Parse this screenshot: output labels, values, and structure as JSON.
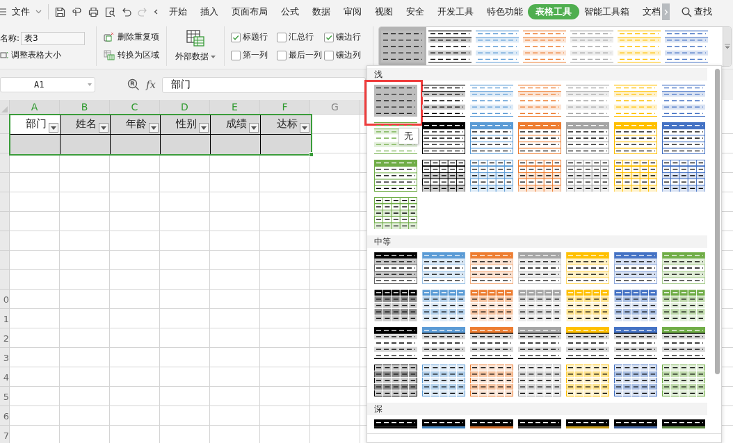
{
  "toolbar": {
    "file_menu": "文件",
    "tabs": [
      {
        "label": "开始",
        "selected": false
      },
      {
        "label": "插入",
        "selected": false
      },
      {
        "label": "页面布局",
        "selected": false
      },
      {
        "label": "公式",
        "selected": false
      },
      {
        "label": "数据",
        "selected": false
      },
      {
        "label": "审阅",
        "selected": false
      },
      {
        "label": "视图",
        "selected": false
      },
      {
        "label": "安全",
        "selected": false
      },
      {
        "label": "开发工具",
        "selected": false
      },
      {
        "label": "特色功能",
        "selected": false
      },
      {
        "label": "表格工具",
        "selected": true
      },
      {
        "label": "智能工具箱",
        "selected": false
      },
      {
        "label": "文档",
        "selected": false
      }
    ],
    "search": "查找"
  },
  "ribbon": {
    "table_name_label": "名称:",
    "table_name": "表3",
    "resize_button": "调整表格大小",
    "remove_duplicates_button": "删除重复项",
    "convert_button": "转换为区域",
    "external_data_button": "外部数据",
    "options": [
      {
        "label": "标题行",
        "checked": true
      },
      {
        "label": "汇总行",
        "checked": false
      },
      {
        "label": "镶边行",
        "checked": true
      },
      {
        "label": "第一列",
        "checked": false
      },
      {
        "label": "最后一列",
        "checked": false
      },
      {
        "label": "镶边列",
        "checked": false
      }
    ],
    "style_strip": [
      {
        "kind": "none",
        "color": "#bdbdbd",
        "selected": true
      },
      {
        "kind": "banded",
        "color": "#000000",
        "selected": false
      },
      {
        "kind": "banded",
        "color": "#5b9bd5",
        "selected": false
      },
      {
        "kind": "banded",
        "color": "#ed7d31",
        "selected": false
      },
      {
        "kind": "banded",
        "color": "#a5a5a5",
        "selected": false
      },
      {
        "kind": "banded",
        "color": "#ffc000",
        "selected": false
      },
      {
        "kind": "banded",
        "color": "#4472c4",
        "selected": false
      }
    ]
  },
  "formula_bar": {
    "cell_ref": "A1",
    "function_label": "fx",
    "value": "部门"
  },
  "sheet": {
    "columns": [
      {
        "label": "A",
        "selected": true
      },
      {
        "label": "B",
        "selected": true
      },
      {
        "label": "C",
        "selected": true
      },
      {
        "label": "D",
        "selected": true
      },
      {
        "label": "E",
        "selected": true
      },
      {
        "label": "F",
        "selected": true
      },
      {
        "label": "G",
        "selected": false
      }
    ],
    "headers": [
      {
        "text": "部门",
        "active": true
      },
      {
        "text": "姓名",
        "active": false
      },
      {
        "text": "年龄",
        "active": false
      },
      {
        "text": "性别",
        "active": false
      },
      {
        "text": "成绩",
        "active": false
      },
      {
        "text": "达标",
        "active": false
      }
    ],
    "row_number_tails": [
      "0",
      "1",
      "2",
      "3",
      "4",
      "5",
      "6",
      "7"
    ]
  },
  "style_gallery": {
    "tooltip": "无",
    "sections": [
      {
        "title": "浅",
        "items": [
          {
            "kind": "none",
            "color": "#bdbdbd",
            "selected": true
          },
          {
            "kind": "banded",
            "color": "#000000",
            "selected": false
          },
          {
            "kind": "banded",
            "color": "#5b9bd5",
            "selected": false
          },
          {
            "kind": "banded",
            "color": "#ed7d31",
            "selected": false
          },
          {
            "kind": "banded",
            "color": "#a5a5a5",
            "selected": false
          },
          {
            "kind": "banded",
            "color": "#ffc000",
            "selected": false
          },
          {
            "kind": "banded",
            "color": "#4472c4",
            "selected": false
          },
          {
            "kind": "banded",
            "color": "#70ad47",
            "selected": false
          },
          {
            "kind": "header",
            "color": "#000000",
            "selected": false
          },
          {
            "kind": "header",
            "color": "#5b9bd5",
            "selected": false
          },
          {
            "kind": "header",
            "color": "#ed7d31",
            "selected": false
          },
          {
            "kind": "header",
            "color": "#a5a5a5",
            "selected": false
          },
          {
            "kind": "header",
            "color": "#ffc000",
            "selected": false
          },
          {
            "kind": "header",
            "color": "#4472c4",
            "selected": false
          },
          {
            "kind": "header",
            "color": "#70ad47",
            "selected": false
          },
          {
            "kind": "grid",
            "color": "#000000",
            "selected": false
          },
          {
            "kind": "grid",
            "color": "#5b9bd5",
            "selected": false
          },
          {
            "kind": "grid",
            "color": "#ed7d31",
            "selected": false
          },
          {
            "kind": "grid",
            "color": "#a5a5a5",
            "selected": false
          },
          {
            "kind": "grid",
            "color": "#ffc000",
            "selected": false
          },
          {
            "kind": "grid",
            "color": "#4472c4",
            "selected": false
          },
          {
            "kind": "grid",
            "color": "#70ad47",
            "selected": false
          }
        ]
      },
      {
        "title": "中等",
        "items": [
          {
            "kind": "m-header",
            "color": "#000000",
            "selected": false
          },
          {
            "kind": "m-header",
            "color": "#5b9bd5",
            "selected": false
          },
          {
            "kind": "m-header",
            "color": "#ed7d31",
            "selected": false
          },
          {
            "kind": "m-header",
            "color": "#a5a5a5",
            "selected": false
          },
          {
            "kind": "m-header",
            "color": "#ffc000",
            "selected": false
          },
          {
            "kind": "m-header",
            "color": "#4472c4",
            "selected": false
          },
          {
            "kind": "m-header",
            "color": "#70ad47",
            "selected": false
          },
          {
            "kind": "m-cells",
            "color": "#000000",
            "selected": false
          },
          {
            "kind": "m-cells",
            "color": "#5b9bd5",
            "selected": false
          },
          {
            "kind": "m-cells",
            "color": "#ed7d31",
            "selected": false
          },
          {
            "kind": "m-cells",
            "color": "#a5a5a5",
            "selected": false
          },
          {
            "kind": "m-cells",
            "color": "#ffc000",
            "selected": false
          },
          {
            "kind": "m-cells",
            "color": "#4472c4",
            "selected": false
          },
          {
            "kind": "m-cells",
            "color": "#70ad47",
            "selected": false
          },
          {
            "kind": "m-lines",
            "color": "#000000",
            "selected": false
          },
          {
            "kind": "m-lines",
            "color": "#5b9bd5",
            "selected": false
          },
          {
            "kind": "m-lines",
            "color": "#ed7d31",
            "selected": false
          },
          {
            "kind": "m-lines",
            "color": "#a5a5a5",
            "selected": false
          },
          {
            "kind": "m-lines",
            "color": "#ffc000",
            "selected": false
          },
          {
            "kind": "m-lines",
            "color": "#4472c4",
            "selected": false
          },
          {
            "kind": "m-lines",
            "color": "#70ad47",
            "selected": false
          },
          {
            "kind": "m-grid",
            "color": "#000000",
            "selected": false
          },
          {
            "kind": "m-grid",
            "color": "#5b9bd5",
            "selected": false
          },
          {
            "kind": "m-grid",
            "color": "#ed7d31",
            "selected": false
          },
          {
            "kind": "m-grid",
            "color": "#a5a5a5",
            "selected": false
          },
          {
            "kind": "m-grid",
            "color": "#ffc000",
            "selected": false
          },
          {
            "kind": "m-grid",
            "color": "#4472c4",
            "selected": false
          },
          {
            "kind": "m-grid",
            "color": "#70ad47",
            "selected": false
          }
        ]
      },
      {
        "title": "深",
        "items": [
          {
            "kind": "dark",
            "color": "#000000",
            "selected": false
          },
          {
            "kind": "dark",
            "color": "#2e75b6",
            "selected": false
          },
          {
            "kind": "dark",
            "color": "#c55a11",
            "selected": false
          },
          {
            "kind": "dark",
            "color": "#333333",
            "selected": false
          },
          {
            "kind": "dark",
            "color": "#bf9000",
            "selected": false
          },
          {
            "kind": "dark",
            "color": "#2f5597",
            "selected": false
          },
          {
            "kind": "dark",
            "color": "#548235",
            "selected": false
          }
        ]
      }
    ]
  }
}
